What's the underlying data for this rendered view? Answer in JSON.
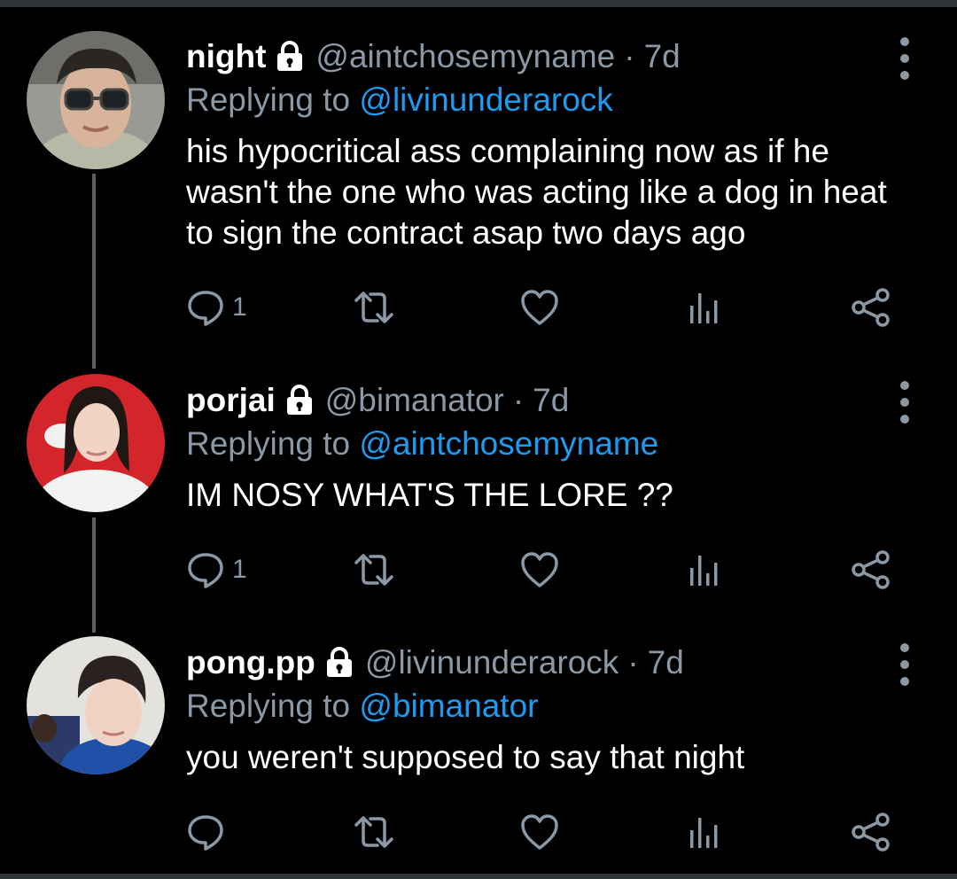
{
  "tweets": [
    {
      "display_name": "night",
      "handle": "@aintchosemyname",
      "separator": "·",
      "time": "7d",
      "replying_prefix": "Replying to",
      "replying_to": "@livinunderarock",
      "text": "his hypocritical ass complaining now as if he wasn't the one who was acting like a dog in heat to sign the contract asap two days ago",
      "reply_count": "1",
      "locked": true
    },
    {
      "display_name": "porjai",
      "handle": "@bimanator",
      "separator": "·",
      "time": "7d",
      "replying_prefix": "Replying to",
      "replying_to": "@aintchosemyname",
      "text": "IM NOSY WHAT'S THE LORE ??",
      "reply_count": "1",
      "locked": true
    },
    {
      "display_name": "pong.pp",
      "handle": "@livinunderarock",
      "separator": "·",
      "time": "7d",
      "replying_prefix": "Replying to",
      "replying_to": "@bimanator",
      "text": "you weren't supposed to say that night",
      "reply_count": "",
      "locked": true
    }
  ],
  "icons": {
    "reply": "comment-bubble-icon",
    "retweet": "retweet-icon",
    "like": "heart-icon",
    "views": "bar-chart-icon",
    "share": "share-icon",
    "more": "vertical-dots-icon",
    "protected": "lock-icon"
  },
  "colors": {
    "background": "#000000",
    "text": "#ffffff",
    "muted": "#8b98a5",
    "link": "#1d9bf0",
    "thread_line": "#5b5f63"
  }
}
